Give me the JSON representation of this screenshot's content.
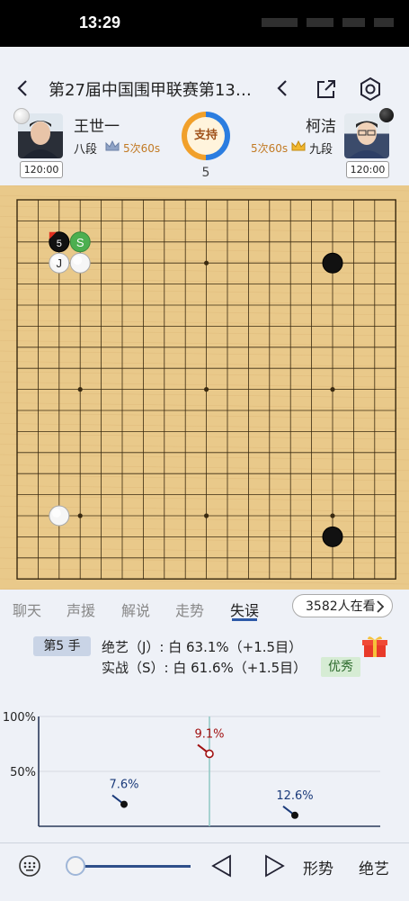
{
  "status_bar": {
    "time": "13:29"
  },
  "header": {
    "title": "第27届中国围甲联赛第13轮..."
  },
  "players": {
    "white": {
      "name": "王世一",
      "rank": "八段",
      "byoyomi": "5次60s",
      "clock": "120:00"
    },
    "black": {
      "name": "柯洁",
      "rank": "九段",
      "byoyomi": "5次60s",
      "clock": "120:00"
    }
  },
  "support": {
    "label": "支持"
  },
  "move_number": "5",
  "board": {
    "size": 19,
    "wood_color": "#e9c98a",
    "line_color": "#3a2a10",
    "star_points": [
      [
        3,
        3
      ],
      [
        3,
        9
      ],
      [
        3,
        15
      ],
      [
        9,
        3
      ],
      [
        9,
        9
      ],
      [
        9,
        15
      ],
      [
        15,
        3
      ],
      [
        15,
        9
      ],
      [
        15,
        15
      ]
    ],
    "stones": [
      {
        "col": 15,
        "row": 3,
        "color": "black"
      },
      {
        "col": 15,
        "row": 16,
        "color": "black"
      },
      {
        "col": 2,
        "row": 15,
        "color": "white"
      },
      {
        "col": 3,
        "row": 3,
        "color": "white"
      },
      {
        "col": 2,
        "row": 2,
        "color": "black",
        "label": "5",
        "last_move": true
      },
      {
        "col": 2,
        "row": 3,
        "color": "white",
        "label": "J"
      },
      {
        "col": 3,
        "row": 2,
        "color": "green",
        "label": "S"
      }
    ]
  },
  "tabs": [
    "聊天",
    "声援",
    "解说",
    "走势",
    "失误"
  ],
  "active_tab": "失误",
  "viewers": "3582人在看",
  "analysis": {
    "move_badge": "第5 手",
    "line1": "绝艺（J）: 白 63.1%（+1.5目）",
    "line2": "实战（S）: 白 61.6%（+1.5目）",
    "rating": "优秀"
  },
  "chart_data": {
    "type": "scatter",
    "y_tick_labels": [
      "100%",
      "50%"
    ],
    "ylim": [
      0,
      100
    ],
    "points": [
      {
        "x": 2,
        "y": 20,
        "label": "7.6%",
        "color": "#1a3a7a",
        "label_color": "#1a3a7a"
      },
      {
        "x": 4,
        "y": 66,
        "label": "9.1%",
        "color": "#a01010",
        "label_color": "#a01010",
        "hollow": true
      },
      {
        "x": 6,
        "y": 10,
        "label": "12.6%",
        "color": "#1a3a7a",
        "label_color": "#1a3a7a"
      }
    ],
    "current_x": 4,
    "xlim": [
      0,
      8
    ]
  },
  "bottom_bar": {
    "shape_label": "形势",
    "ai_label": "绝艺",
    "slider_value": 0
  },
  "colors": {
    "accent": "#2e5aa8",
    "tab_inactive": "#888888"
  }
}
